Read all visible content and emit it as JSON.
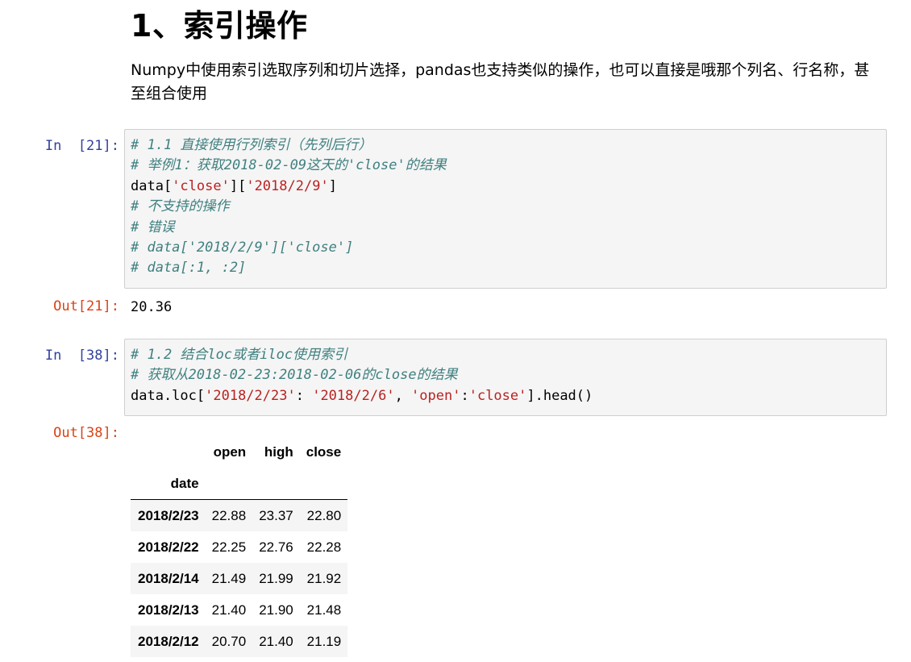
{
  "markdown": {
    "title": "1、索引操作",
    "paragraph": "Numpy中使用索引选取序列和切片选择，pandas也支持类似的操作，也可以直接是哦那个列名、行名称，甚至组合使用"
  },
  "cells": [
    {
      "in_prompt": "In  [21]:",
      "lines": [
        [
          {
            "t": "cm",
            "v": "# 1.1 直接使用行列索引（先列后行）"
          }
        ],
        [
          {
            "t": "cm",
            "v": "# 举例1：获取2018-02-09这天的'close'的结果"
          }
        ],
        [
          {
            "t": "pl",
            "v": "data["
          },
          {
            "t": "str",
            "v": "'close'"
          },
          {
            "t": "pl",
            "v": "]["
          },
          {
            "t": "str",
            "v": "'2018/2/9'"
          },
          {
            "t": "pl",
            "v": "]"
          }
        ],
        [
          {
            "t": "cm",
            "v": "# 不支持的操作"
          }
        ],
        [
          {
            "t": "cm",
            "v": "# 错误"
          }
        ],
        [
          {
            "t": "cm",
            "v": "# data['2018/2/9']['close']"
          }
        ],
        [
          {
            "t": "cm",
            "v": "# data[:1, :2]"
          }
        ]
      ],
      "out_prompt": "Out[21]:",
      "output": "20.36"
    },
    {
      "in_prompt": "In  [38]:",
      "lines": [
        [
          {
            "t": "cm",
            "v": "# 1.2 结合loc或者iloc使用索引"
          }
        ],
        [
          {
            "t": "cm",
            "v": "# 获取从2018-02-23:2018-02-06的close的结果"
          }
        ],
        [
          {
            "t": "pl",
            "v": "data.loc["
          },
          {
            "t": "str",
            "v": "'2018/2/23'"
          },
          {
            "t": "pl",
            "v": ": "
          },
          {
            "t": "str",
            "v": "'2018/2/6'"
          },
          {
            "t": "pl",
            "v": ", "
          },
          {
            "t": "str",
            "v": "'open'"
          },
          {
            "t": "pl",
            "v": ":"
          },
          {
            "t": "str",
            "v": "'close'"
          },
          {
            "t": "pl",
            "v": "].head()"
          }
        ]
      ],
      "out_prompt": "Out[38]:"
    }
  ],
  "dataframe": {
    "columns": [
      "open",
      "high",
      "close"
    ],
    "index_name": "date",
    "rows": [
      {
        "index": "2018/2/23",
        "values": [
          "22.88",
          "23.37",
          "22.80"
        ]
      },
      {
        "index": "2018/2/22",
        "values": [
          "22.25",
          "22.76",
          "22.28"
        ]
      },
      {
        "index": "2018/2/14",
        "values": [
          "21.49",
          "21.99",
          "21.92"
        ]
      },
      {
        "index": "2018/2/13",
        "values": [
          "21.40",
          "21.90",
          "21.48"
        ]
      },
      {
        "index": "2018/2/12",
        "values": [
          "20.70",
          "21.40",
          "21.19"
        ]
      }
    ]
  }
}
